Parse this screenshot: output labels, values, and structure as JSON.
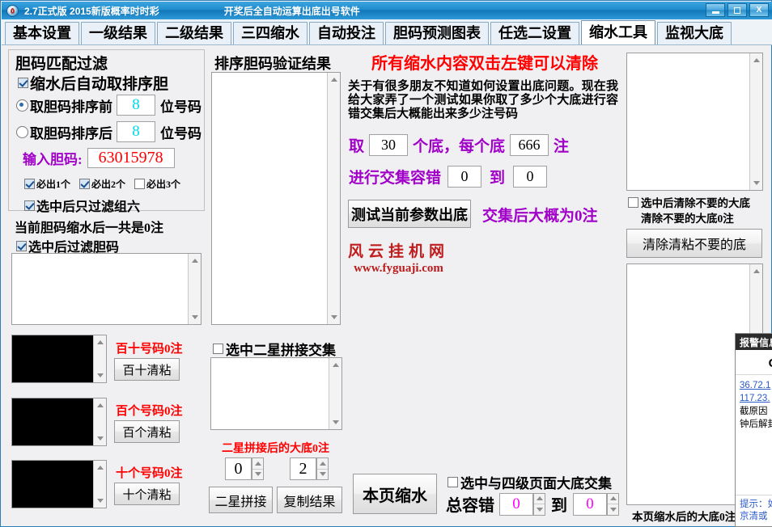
{
  "window": {
    "title": "2.7正式版 2015新版概率时时彩",
    "subtitle": "开奖后全自动运算出底出号软件",
    "minimize_label": "",
    "maximize_label": "",
    "close_label": "X"
  },
  "tabs": [
    {
      "label": "基本设置",
      "active": false
    },
    {
      "label": "一级结果",
      "active": false
    },
    {
      "label": "二级结果",
      "active": false
    },
    {
      "label": "三四缩水",
      "active": false
    },
    {
      "label": "自动投注",
      "active": false
    },
    {
      "label": "胆码预测图表",
      "active": false
    },
    {
      "label": "任选二设置",
      "active": false
    },
    {
      "label": "缩水工具",
      "active": true
    },
    {
      "label": "监视大底",
      "active": false
    }
  ],
  "left": {
    "group_title": "胆码匹配过滤",
    "auto_sort_label": "缩水后自动取排序胆",
    "auto_sort_checked": true,
    "take_before_label": "取胆码排序前",
    "take_before_value": "8",
    "take_before_suffix": "位号码",
    "take_before_selected": true,
    "take_after_label": "取胆码排序后",
    "take_after_value": "8",
    "take_after_suffix": "位号码",
    "take_after_selected": false,
    "input_dan_label": "输入胆码:",
    "input_dan_value": "63015978",
    "must1_label": "必出1个",
    "must1_checked": true,
    "must2_label": "必出2个",
    "must2_checked": true,
    "must3_label": "必出3个",
    "must3_checked": false,
    "only_group6_label": "选中后只过滤组六",
    "only_group6_checked": true,
    "current_total_label": "当前胆码缩水后一共是0注",
    "filter_dan_label": "选中后过滤胆码",
    "filter_dan_checked": true,
    "baishi_count_label": "百十号码0注",
    "baishi_btn": "百十清粘",
    "baige_count_label": "百个号码0注",
    "baige_btn": "百个清粘",
    "shige_count_label": "十个号码0注",
    "shige_btn": "十个清粘"
  },
  "mid": {
    "sort_result_title": "排序胆码验证结果",
    "erxing_check_label": "选中二星拼接交集",
    "erxing_checked": false,
    "erxing_result_label": "二星拼接后的大底0注",
    "spin_left_value": "0",
    "spin_right_value": "2",
    "btn_erxing": "二星拼接",
    "btn_copy": "复制结果"
  },
  "center": {
    "headline": "所有缩水内容双击左键可以清除",
    "paragraph": "关于有很多朋友不知道如何设置出底问题。现在我给大家弄了一个测试如果你取了多少个大底进行容错交集后大概能出来多少注号码",
    "qu_label": "取",
    "qu_value": "30",
    "ge_di_label": "个底，每个底",
    "zhu_value": "666",
    "zhu_label": "注",
    "rongcuo_label": "进行交集容错",
    "rongcuo_from": "0",
    "rongcuo_to_label": "到",
    "rongcuo_to": "0",
    "test_btn": "测试当前参数出底",
    "result_text": "交集后大概为0注",
    "watermark_cn": "风云挂机网",
    "watermark_url": "www.fyguaji.com",
    "page_shrink_btn": "本页缩水",
    "level4_check_label": "选中与四级页面大底交集",
    "level4_checked": false,
    "total_rongcuo_label": "总容错",
    "total_from": "0",
    "total_to_label": "到",
    "total_to": "0"
  },
  "right": {
    "clear_check_label": "选中后清除不要的大底",
    "clear_checked": false,
    "clear_count_label": "清除不要的大底0注",
    "clear_btn": "清除清粘不要的底",
    "page_result_label": "本页缩水后的大底0注"
  },
  "alert": {
    "title": "报警信息",
    "heading": "CC攻",
    "ip1": "36.72.1",
    "ip2": "117.23.",
    "line1": "截原因",
    "line2": "钟后解封",
    "footer1": "提示：如",
    "footer2": "京清或"
  },
  "colors": {
    "accent_blue": "#1e8ccc",
    "red": "#ff0000",
    "purple": "#a000c8",
    "magenta": "#ff00ff",
    "cyan": "#00d8e8",
    "link": "#2a58c8"
  }
}
